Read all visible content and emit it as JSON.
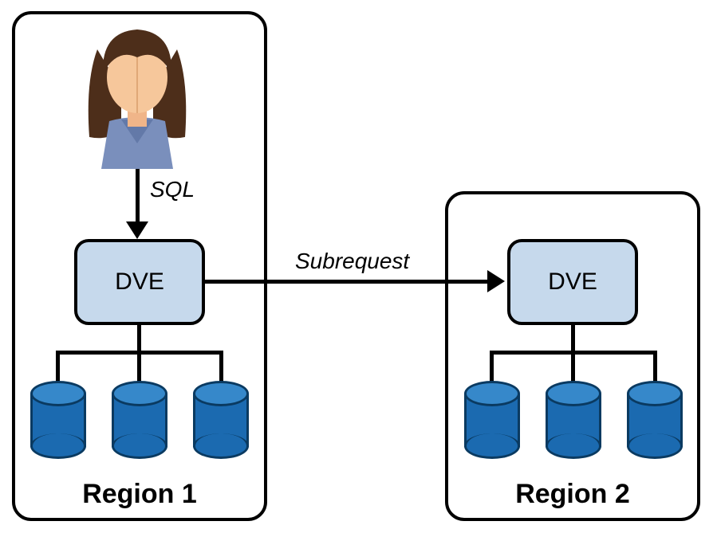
{
  "diagram": {
    "region1": {
      "label": "Region 1",
      "dve_label": "DVE"
    },
    "region2": {
      "label": "Region 2",
      "dve_label": "DVE"
    },
    "arrows": {
      "sql_label": "SQL",
      "subrequest_label": "Subrequest"
    }
  }
}
